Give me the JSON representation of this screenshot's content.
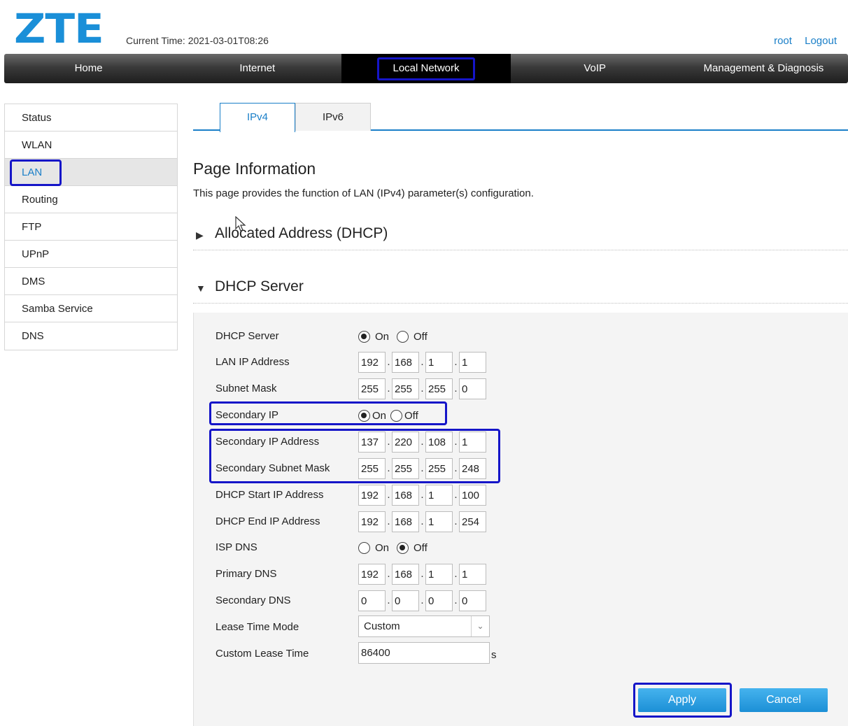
{
  "brand": {
    "logo": "ZTE",
    "color": "#1a8fd8"
  },
  "header": {
    "current_time": "Current Time: 2021-03-01T08:26",
    "user": "root",
    "logout": "Logout"
  },
  "nav": {
    "items": [
      {
        "label": "Home"
      },
      {
        "label": "Internet"
      },
      {
        "label": "Local Network",
        "active": true
      },
      {
        "label": "VoIP"
      },
      {
        "label": "Management & Diagnosis"
      }
    ]
  },
  "sidebar": {
    "items": [
      {
        "label": "Status"
      },
      {
        "label": "WLAN"
      },
      {
        "label": "LAN",
        "active": true
      },
      {
        "label": "Routing"
      },
      {
        "label": "FTP"
      },
      {
        "label": "UPnP"
      },
      {
        "label": "DMS"
      },
      {
        "label": "Samba Service"
      },
      {
        "label": "DNS"
      }
    ]
  },
  "tabs": [
    {
      "label": "IPv4",
      "active": true
    },
    {
      "label": "IPv6"
    }
  ],
  "page": {
    "title": "Page Information",
    "description": "This page provides the function of LAN (IPv4) parameter(s) configuration."
  },
  "sections": {
    "allocated": {
      "title": "Allocated Address (DHCP)",
      "arrow": "▶"
    },
    "dhcp": {
      "title": "DHCP Server",
      "arrow": "▼"
    }
  },
  "form": {
    "dhcp_server": {
      "label": "DHCP Server",
      "on_label": "On",
      "off_label": "Off",
      "value": "On"
    },
    "lan_ip": {
      "label": "LAN IP Address",
      "octets": [
        "192",
        "168",
        "1",
        "1"
      ]
    },
    "subnet_mask": {
      "label": "Subnet Mask",
      "octets": [
        "255",
        "255",
        "255",
        "0"
      ]
    },
    "secondary_ip": {
      "label": "Secondary IP",
      "on_label": "On",
      "off_label": "Off",
      "value": "On"
    },
    "secondary_ip_address": {
      "label": "Secondary IP Address",
      "octets": [
        "137",
        "220",
        "108",
        "1"
      ]
    },
    "secondary_subnet_mask": {
      "label": "Secondary Subnet Mask",
      "octets": [
        "255",
        "255",
        "255",
        "248"
      ]
    },
    "dhcp_start": {
      "label": "DHCP Start IP Address",
      "octets": [
        "192",
        "168",
        "1",
        "100"
      ]
    },
    "dhcp_end": {
      "label": "DHCP End IP Address",
      "octets": [
        "192",
        "168",
        "1",
        "254"
      ]
    },
    "isp_dns": {
      "label": "ISP DNS",
      "on_label": "On",
      "off_label": "Off",
      "value": "Off"
    },
    "primary_dns": {
      "label": "Primary DNS",
      "octets": [
        "192",
        "168",
        "1",
        "1"
      ]
    },
    "secondary_dns": {
      "label": "Secondary DNS",
      "octets": [
        "0",
        "0",
        "0",
        "0"
      ]
    },
    "lease_time_mode": {
      "label": "Lease Time Mode",
      "value": "Custom"
    },
    "custom_lease_time": {
      "label": "Custom Lease Time",
      "value": "86400",
      "unit": "s"
    }
  },
  "buttons": {
    "apply": "Apply",
    "cancel": "Cancel"
  },
  "colors": {
    "accent": "#1a7fc8",
    "highlight": "#1515c8",
    "button": "#2a9de0"
  }
}
